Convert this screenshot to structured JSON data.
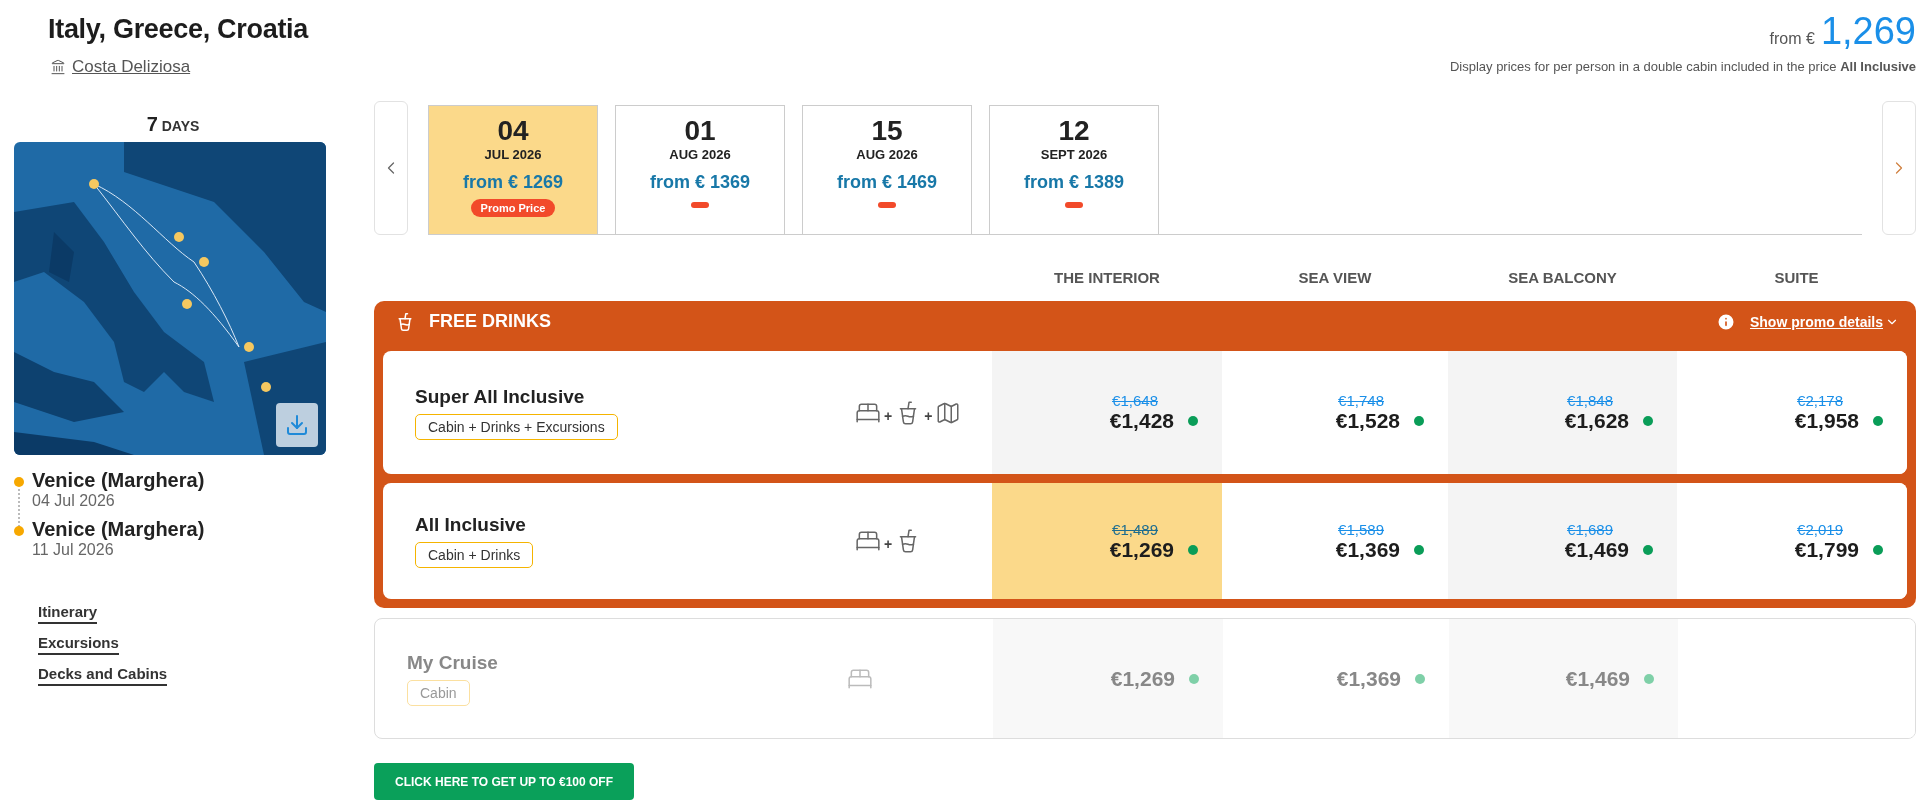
{
  "trip": {
    "title": "Italy, Greece, Croatia",
    "ship": "Costa Deliziosa"
  },
  "duration": {
    "number": "7",
    "unit": "DAYS"
  },
  "map": {
    "kind": "picture"
  },
  "ports": [
    {
      "name": "Venice (Marghera)",
      "date": "04 Jul 2026"
    },
    {
      "name": "Venice (Marghera)",
      "date": "11 Jul 2026"
    }
  ],
  "links": [
    "Itinerary",
    "Excursions",
    "Decks and Cabins"
  ],
  "price_summary": {
    "prefix": "from €",
    "amount": "1,269",
    "note": "Display prices for per person in a double cabin included in the price **All Inclusive**"
  },
  "dates": [
    {
      "day": "04",
      "month": "JUL 2026",
      "price": "from € 1269",
      "selected": true,
      "badge": "Promo Price"
    },
    {
      "day": "01",
      "month": "AUG 2026",
      "price": "from € 1369",
      "selected": false
    },
    {
      "day": "15",
      "month": "AUG 2026",
      "price": "from € 1469",
      "selected": false
    },
    {
      "day": "12",
      "month": "SEPT 2026",
      "price": "from € 1389",
      "selected": false
    }
  ],
  "columns": [
    "THE INTERIOR",
    "SEA VIEW",
    "SEA BALCONY",
    "SUITE"
  ],
  "promo": {
    "title": "FREE DRINKS",
    "details_link": "Show promo details",
    "rows": [
      {
        "name": "Super All Inclusive",
        "tag": "Cabin + Drinks + Excursions",
        "disabled": false,
        "includes": [
          {
            "kind": "bed"
          },
          {
            "kind": "plus",
            "text": "+"
          },
          {
            "kind": "drink"
          },
          {
            "kind": "plus",
            "text": "+"
          },
          {
            "kind": "map"
          }
        ],
        "cells": [
          {
            "old_price": "€1,648",
            "price": "€1,428",
            "selected": false
          },
          {
            "old_price": "€1,748",
            "price": "€1,528",
            "selected": false
          },
          {
            "old_price": "€1,848",
            "price": "€1,628",
            "selected": false
          },
          {
            "old_price": "€2,178",
            "price": "€1,958",
            "selected": false
          }
        ]
      },
      {
        "name": "All Inclusive",
        "tag": "Cabin + Drinks",
        "disabled": false,
        "includes": [
          {
            "kind": "bed"
          },
          {
            "kind": "plus",
            "text": "+"
          },
          {
            "kind": "drink"
          }
        ],
        "cells": [
          {
            "old_price": "€1,489",
            "price": "€1,269",
            "selected": true
          },
          {
            "old_price": "€1,589",
            "price": "€1,369",
            "selected": false
          },
          {
            "old_price": "€1,689",
            "price": "€1,469",
            "selected": false
          },
          {
            "old_price": "€2,019",
            "price": "€1,799",
            "selected": false
          }
        ]
      }
    ]
  },
  "other_rows": [
    {
      "name": "My Cruise",
      "tag": "Cabin",
      "disabled": true,
      "includes": [
        {
          "kind": "bed"
        }
      ],
      "cells": [
        {
          "price": "€1,269",
          "selected": false
        },
        {
          "price": "€1,369",
          "selected": false
        },
        {
          "price": "€1,469",
          "selected": false
        }
      ]
    }
  ],
  "cta": "CLICK HERE TO GET UP TO €100 OFF"
}
